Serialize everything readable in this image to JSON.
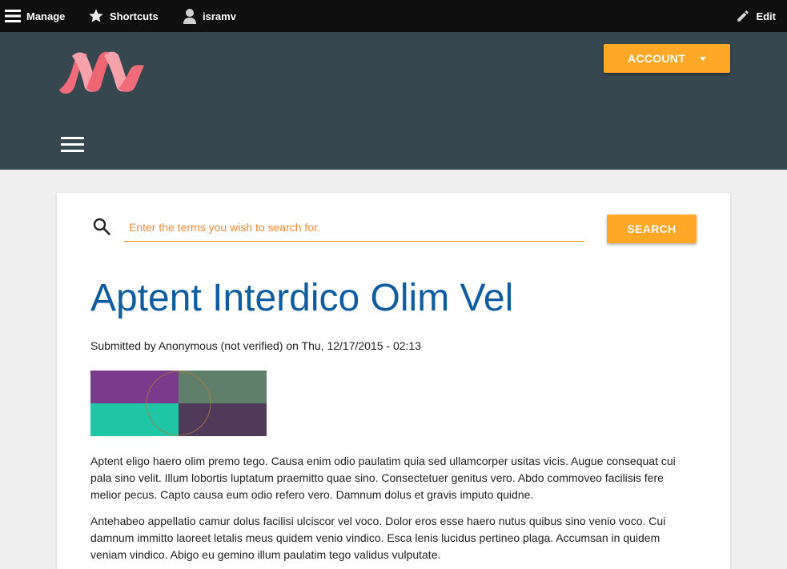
{
  "toolbar": {
    "manage": "Manage",
    "shortcuts": "Shortcuts",
    "user": "isramv",
    "edit": "Edit"
  },
  "header": {
    "account_label": "ACCOUNT",
    "accent_color": "#ffa726",
    "background_color": "#37474f"
  },
  "search": {
    "placeholder": "Enter the terms you wish to search for.",
    "button_label": "SEARCH"
  },
  "article": {
    "title": "Aptent Interdico Olim Vel",
    "submitted": "Submitted by Anonymous (not verified) on Thu, 12/17/2015 - 02:13",
    "paragraphs": [
      "Aptent eligo haero olim premo tego. Causa enim odio paulatim quia sed ullamcorper usitas vicis. Augue consequat cui pala sino velit. Illum lobortis luptatum praemitto quae sino. Consectetuer genitus vero. Abdo commoveo facilisis fere melior pecus. Capto causa eum odio refero vero. Damnum dolus et gravis imputo quidne.",
      "Antehabeo appellatio camur dolus facilisi ulciscor vel voco. Dolor eros esse haero nutus quibus sino venio voco. Cui damnum immitto laoreet letalis meus quidem venio vindico. Esca lenis lucidus pertineo plaga. Accumsan in quidem veniam vindico. Abigo eu gemino illum paulatim tego validus vulputate."
    ]
  }
}
